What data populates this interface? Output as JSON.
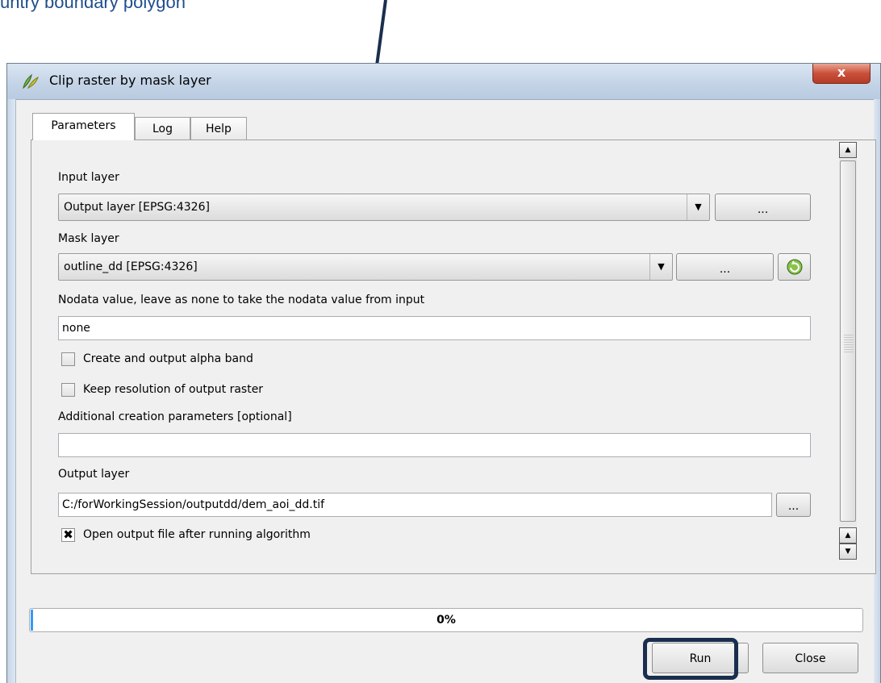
{
  "annotation": {
    "text": "untry boundary polygon"
  },
  "window": {
    "title": "Clip raster by mask layer",
    "close_glyph": "x"
  },
  "tabs": [
    {
      "label": "Parameters",
      "active": true
    },
    {
      "label": "Log",
      "active": false
    },
    {
      "label": "Help",
      "active": false
    }
  ],
  "params": {
    "input_layer": {
      "label": "Input layer",
      "value": "Output layer [EPSG:4326]",
      "browse": "..."
    },
    "mask_layer": {
      "label": "Mask layer",
      "value": "outline_dd [EPSG:4326]",
      "browse": "..."
    },
    "nodata": {
      "label": "Nodata value, leave as none to take the nodata value from input",
      "value": "none"
    },
    "alpha_band": {
      "label": "Create and output alpha band",
      "checked": false
    },
    "keep_resolution": {
      "label": "Keep resolution of output raster",
      "checked": false
    },
    "creation_params": {
      "label": "Additional creation parameters [optional]",
      "value": ""
    },
    "output_layer": {
      "label": "Output layer",
      "value": "C:/forWorkingSession/outputdd/dem_aoi_dd.tif",
      "browse": "..."
    },
    "open_output": {
      "label": "Open output file after running algorithm",
      "checked": true,
      "mark": "✖"
    }
  },
  "progress": {
    "value": 0,
    "label": "0%"
  },
  "buttons": {
    "run": "Run",
    "close": "Close"
  },
  "colors": {
    "annotation": "#1f4e8c",
    "highlight": "#1a2e4d",
    "progress_fill": "#3399ff"
  }
}
